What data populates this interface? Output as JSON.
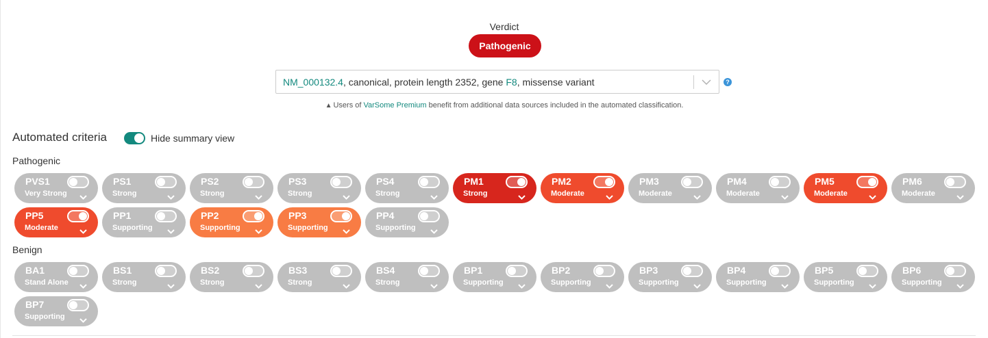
{
  "verdict": {
    "label": "Verdict",
    "value": "Pathogenic",
    "color": "#cc1118"
  },
  "transcript": {
    "accession": "NM_000132.4",
    "text_before_gene": ", canonical, protein length 2352, gene ",
    "gene": "F8",
    "text_after_gene": ", missense variant"
  },
  "help_icon": "question-circle-icon",
  "premium_note": {
    "prefix": "Users of ",
    "link": "VarSome Premium",
    "suffix": " benefit from additional data sources included in the automated classification."
  },
  "automated_criteria": {
    "title": "Automated criteria",
    "toggle_label": "Hide summary view",
    "toggle_on": true
  },
  "groups": {
    "pathogenic_label": "Pathogenic",
    "benign_label": "Benign"
  },
  "colors": {
    "accent": "#13897e",
    "strong": "#d7261d",
    "moderate": "#ef4b2d",
    "supporting": "#f87c44",
    "inactive": "#bfbfbf"
  },
  "pathogenic_rows": [
    [
      {
        "code": "PVS1",
        "strength": "Very Strong",
        "active": false
      },
      {
        "code": "PS1",
        "strength": "Strong",
        "active": false
      },
      {
        "code": "PS2",
        "strength": "Strong",
        "active": false
      },
      {
        "code": "PS3",
        "strength": "Strong",
        "active": false
      },
      {
        "code": "PS4",
        "strength": "Strong",
        "active": false
      },
      {
        "code": "PM1",
        "strength": "Strong",
        "active": true,
        "level": "strong"
      },
      {
        "code": "PM2",
        "strength": "Moderate",
        "active": true,
        "level": "moderate"
      },
      {
        "code": "PM3",
        "strength": "Moderate",
        "active": false
      },
      {
        "code": "PM4",
        "strength": "Moderate",
        "active": false
      },
      {
        "code": "PM5",
        "strength": "Moderate",
        "active": true,
        "level": "moderate"
      },
      {
        "code": "PM6",
        "strength": "Moderate",
        "active": false
      }
    ],
    [
      {
        "code": "PP5",
        "strength": "Moderate",
        "active": true,
        "level": "moderate"
      },
      {
        "code": "PP1",
        "strength": "Supporting",
        "active": false
      },
      {
        "code": "PP2",
        "strength": "Supporting",
        "active": true,
        "level": "supporting"
      },
      {
        "code": "PP3",
        "strength": "Supporting",
        "active": true,
        "level": "supporting"
      },
      {
        "code": "PP4",
        "strength": "Supporting",
        "active": false
      }
    ]
  ],
  "benign_rows": [
    [
      {
        "code": "BA1",
        "strength": "Stand Alone",
        "active": false
      },
      {
        "code": "BS1",
        "strength": "Strong",
        "active": false
      },
      {
        "code": "BS2",
        "strength": "Strong",
        "active": false
      },
      {
        "code": "BS3",
        "strength": "Strong",
        "active": false
      },
      {
        "code": "BS4",
        "strength": "Strong",
        "active": false
      },
      {
        "code": "BP1",
        "strength": "Supporting",
        "active": false
      },
      {
        "code": "BP2",
        "strength": "Supporting",
        "active": false
      },
      {
        "code": "BP3",
        "strength": "Supporting",
        "active": false
      },
      {
        "code": "BP4",
        "strength": "Supporting",
        "active": false
      },
      {
        "code": "BP5",
        "strength": "Supporting",
        "active": false
      },
      {
        "code": "BP6",
        "strength": "Supporting",
        "active": false
      }
    ],
    [
      {
        "code": "BP7",
        "strength": "Supporting",
        "active": false
      }
    ]
  ]
}
